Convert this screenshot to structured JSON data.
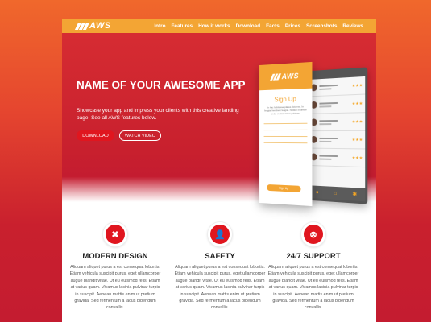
{
  "nav": {
    "logo": "AWS",
    "items": [
      "Intro",
      "Features",
      "How it works",
      "Download",
      "Facts",
      "Prices",
      "Screenshots",
      "Reviews"
    ]
  },
  "hero": {
    "title": "NAME OF YOUR AWESOME APP",
    "subtitle": "Showcase your app and impress your clients with this creative landing page! See all AWS features below.",
    "download_label": "DOWNLOAD",
    "video_label": "WATCH VIDEO"
  },
  "phone": {
    "logo": "AWS",
    "signup_title": "Sign Up",
    "signup_text": "In hac habitasse platea dictumst. In feugiat hendrerit feugiat. Nullam molestie at dui et placerat et pulvinar.",
    "signup_button": "Sign Up",
    "list": [
      {
        "name": "Nelson Brown",
        "sub": "Minimalist"
      },
      {
        "name": "Nelson Brown",
        "sub": "Minimalist"
      },
      {
        "name": "Carla Bird",
        "sub": "Minimalist"
      },
      {
        "name": "Carla Bird",
        "sub": "Minimalist"
      },
      {
        "name": "Nelson Brown",
        "sub": "Minimalist"
      }
    ]
  },
  "features": [
    {
      "icon": "cross-icon",
      "title": "MODERN DESIGN",
      "text": "Aliquam aliquet purus a est consequat lobortis. Etiam vehicula suscipit purus, eget ullamcorper augue blandit vitae. Ut eu euismod felis. Etiam at varius quam. Vivamus lacinia pulvinar turpis in suscipit. Aenean mattis enim ut pretium gravida. Sed fermentum a lacus bibendum convallis."
    },
    {
      "icon": "user-shield-icon",
      "title": "SAFETY",
      "text": "Aliquam aliquet purus a est consequat lobortis. Etiam vehicula suscipit purus, eget ullamcorper augue blandit vitae. Ut eu euismod felis. Etiam at varius quam. Vivamus lacinia pulvinar turpis in suscipit. Aenean mattis enim ut pretium gravida. Sed fermentum a lacus bibendum convallis."
    },
    {
      "icon": "close-circle-icon",
      "title": "24/7 SUPPORT",
      "text": "Aliquam aliquet purus a est consequat lobortis. Etiam vehicula suscipit purus, eget ullamcorper augue blandit vitae. Ut eu euismod felis. Etiam at varius quam. Vivamus lacinia pulvinar turpis in suscipit. Aenean mattis enim ut pretium gravida. Sed fermentum a lacus bibendum convallis."
    }
  ],
  "colors": {
    "accent": "#f3a534",
    "brand_red": "#e0161f",
    "hero_red": "#c8202e"
  }
}
